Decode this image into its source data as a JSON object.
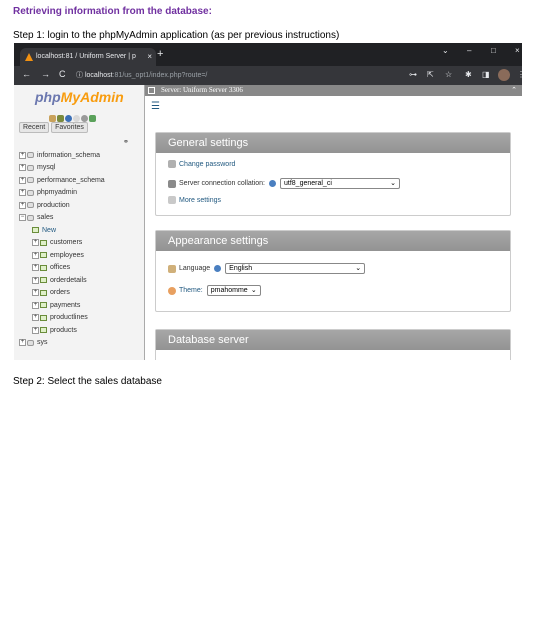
{
  "document": {
    "heading": "Retrieving information from the database:",
    "step1": "Step 1: login to the phpMyAdmin application (as per previous instructions)",
    "step2": "Step 2: Select the sales database"
  },
  "browser": {
    "tab_title": "localhost:81 / Uniform Server | p",
    "tab_close": "×",
    "new_tab": "+",
    "window_controls": [
      "⌄",
      "–",
      "□",
      "×"
    ],
    "url_host": "localhost",
    "url_path": ":81/us_opt1/index.php?route=/",
    "icons": [
      "back-icon",
      "forward-icon",
      "reload-icon",
      "info-icon",
      "key-icon",
      "share-icon",
      "star-icon",
      "extension-icon",
      "sidebar-icon",
      "avatar",
      "menu-icon"
    ]
  },
  "left_pane": {
    "logo_php": "php",
    "logo_myadmin": "MyAdmin",
    "tabs": [
      "Recent",
      "Favorites"
    ],
    "databases": [
      {
        "name": "information_schema",
        "expander": "+"
      },
      {
        "name": "mysql",
        "expander": "+"
      },
      {
        "name": "performance_schema",
        "expander": "+"
      },
      {
        "name": "phpmyadmin",
        "expander": "+"
      },
      {
        "name": "production",
        "expander": "+"
      },
      {
        "name": "sales",
        "expander": "−"
      }
    ],
    "sales_children": [
      "New",
      "customers",
      "employees",
      "offices",
      "orderdetails",
      "orders",
      "payments",
      "productlines",
      "products"
    ],
    "last_db": "sys"
  },
  "right_pane": {
    "server_label": "Server: Uniform Server 3306",
    "general": {
      "title": "General settings",
      "change_password": "Change password",
      "collation_label": "Server connection collation:",
      "collation_value": "utf8_general_ci",
      "more_settings": "More settings"
    },
    "appearance": {
      "title": "Appearance settings",
      "language_label": "Language",
      "language_value": "English",
      "theme_label": "Theme:",
      "theme_value": "pmahomme"
    },
    "database_server": {
      "title": "Database server"
    }
  },
  "colors": {
    "heading": "#7030a0",
    "link": "#235a81",
    "panel_header": "#9a9a9a",
    "chrome_dark": "#202124"
  }
}
